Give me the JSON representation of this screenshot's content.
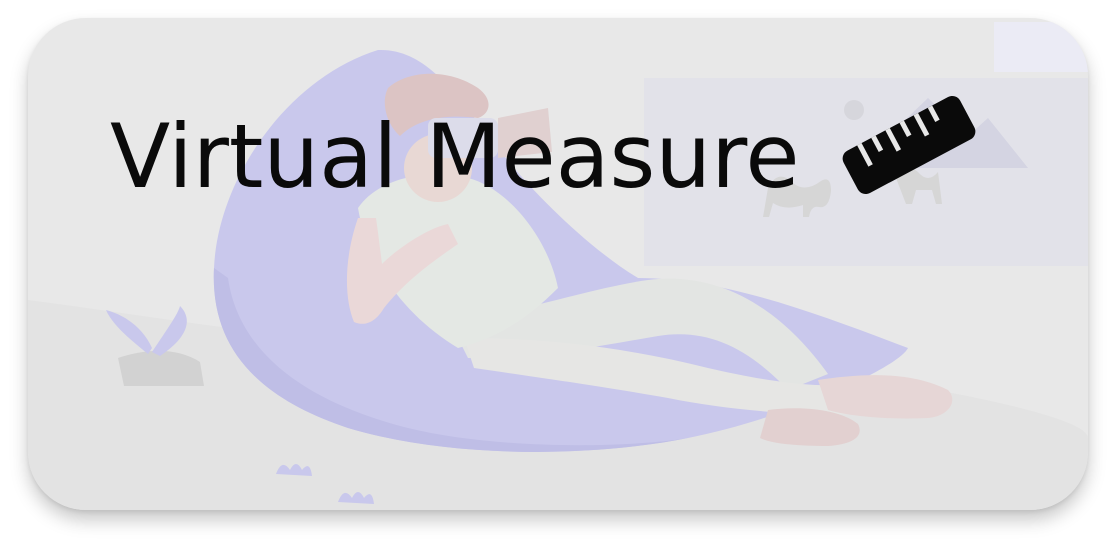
{
  "header": {
    "title": "Virtual Measure"
  },
  "icons": {
    "title_icon": "ruler-icon",
    "background": "person-vr-headset-beanbag-illustration"
  },
  "colors": {
    "card_background": "#e8e8e8",
    "accent_purple": "#c9c8ec",
    "title_text": "#0a0a0a"
  }
}
